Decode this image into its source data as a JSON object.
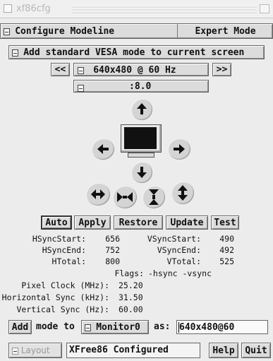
{
  "window": {
    "title": "xf86cfg"
  },
  "menubar": {
    "configure_menu": "Configure Modeline",
    "expert_mode": "Expert Mode"
  },
  "vesa_menu": "Add standard VESA mode to current screen",
  "mode_nav": {
    "prev": "<<",
    "next": ">>",
    "current_mode": "640x480 @ 60 Hz"
  },
  "screen_selector": ":8.0",
  "arrows": {
    "up": "up-arrow-icon",
    "down": "down-arrow-icon",
    "left": "left-arrow-icon",
    "right": "right-arrow-icon",
    "wider": "wider-icon",
    "narrower": "narrower-icon",
    "shorter": "shorter-icon",
    "taller": "taller-icon",
    "monitor": "monitor-icon"
  },
  "actions": {
    "auto": "Auto",
    "apply": "Apply",
    "restore": "Restore",
    "update": "Update",
    "test": "Test"
  },
  "timings": {
    "hsyncstart_label": "HSyncStart:",
    "hsyncstart": "656",
    "vsyncstart_label": "VSyncStart:",
    "vsyncstart": "490",
    "hsyncend_label": "HSyncEnd:",
    "hsyncend": "752",
    "vsyncend_label": "VSyncEnd:",
    "vsyncend": "492",
    "htotal_label": "HTotal:",
    "htotal": "800",
    "vtotal_label": "VTotal:",
    "vtotal": "525",
    "flags_label": "Flags:",
    "flags": "-hsync -vsync",
    "pixel_clock_label": "Pixel Clock (MHz):",
    "pixel_clock": "25.20",
    "hsync_label": "Horizontal Sync (kHz):",
    "hsync": "31.50",
    "vsync_label": "Vertical Sync (Hz):",
    "vsync": "60.00"
  },
  "add_row": {
    "add": "Add",
    "mode_to": "mode to",
    "monitor": "Monitor0",
    "as": "as:",
    "mode_name": "640x480@60"
  },
  "bottom": {
    "layout": "Layout",
    "status": "XFree86 Configured",
    "help": "Help",
    "quit": "Quit"
  },
  "colors": {
    "background": "#ececec",
    "button": "#dcdcdc",
    "arrow": "#111111"
  }
}
